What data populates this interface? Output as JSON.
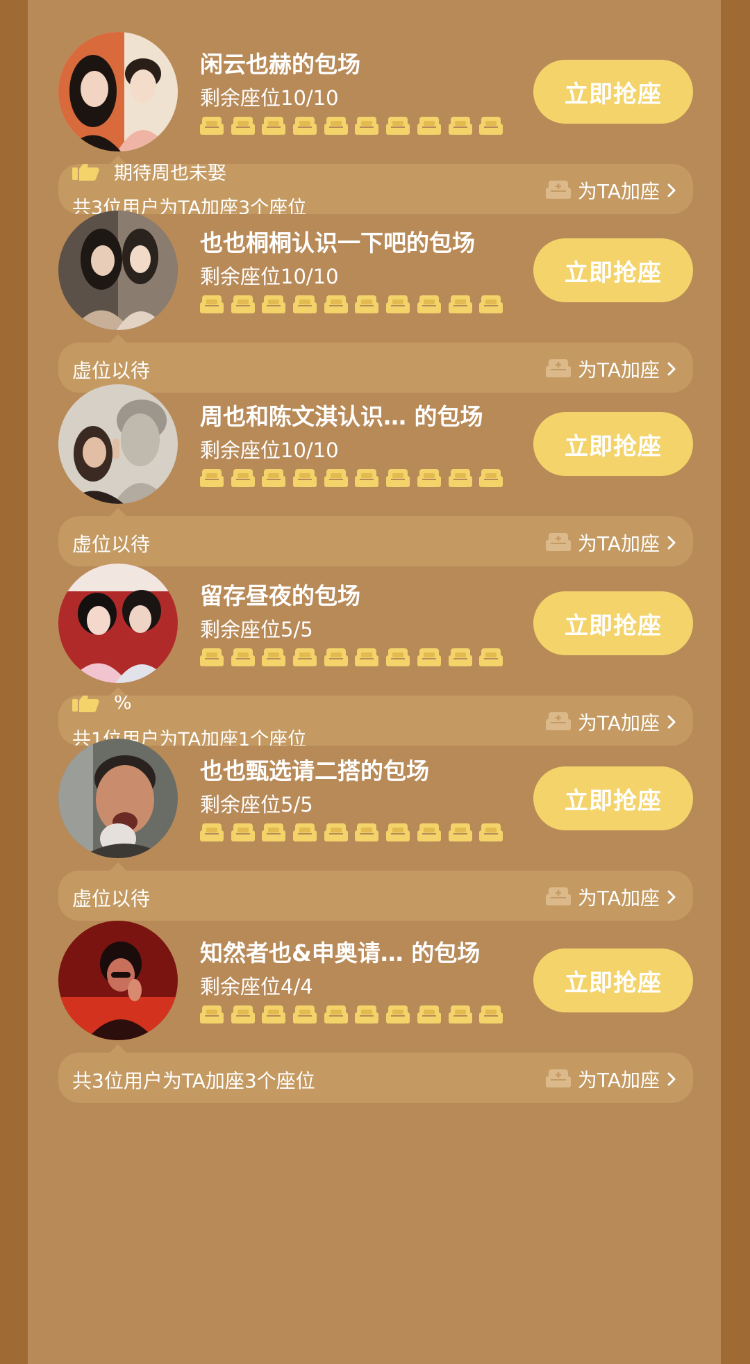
{
  "colors": {
    "page_background": "#a06a35",
    "panel": "#b88a58",
    "button": "#f3d36a",
    "seat": "#f3d36a",
    "bubble": "#c49a62"
  },
  "cards": [
    {
      "title": "闲云也赫的包场",
      "remaining": "剩余座位10/10",
      "seat_count": 10,
      "button_label": "立即抢座",
      "bubble_type": "scroll",
      "bubble_line1": "期待周也未娶",
      "bubble_line2": "共3位用户为TA加座3个座位",
      "add_label": "为TA加座",
      "avatar_icon": "couple-photo"
    },
    {
      "title": "也也桐桐认识一下吧的包场",
      "remaining": "剩余座位10/10",
      "seat_count": 10,
      "button_label": "立即抢座",
      "bubble_type": "text",
      "bubble_text": "虚位以待",
      "add_label": "为TA加座",
      "avatar_icon": "two-women-photo"
    },
    {
      "title": "周也和陈文淇认识… 的包场",
      "remaining": "剩余座位10/10",
      "seat_count": 10,
      "button_label": "立即抢座",
      "bubble_type": "text",
      "bubble_text": "虚位以待",
      "add_label": "为TA加座",
      "avatar_icon": "statue-photo"
    },
    {
      "title": "留存昼夜的包场",
      "remaining": "剩余座位5/5",
      "seat_count": 10,
      "button_label": "立即抢座",
      "bubble_type": "scroll",
      "bubble_line1": "%",
      "bubble_line2": "共1位用户为TA加座1个座位",
      "add_label": "为TA加座",
      "avatar_icon": "two-women-red-photo"
    },
    {
      "title": "也也甄选请二搭的包场",
      "remaining": "剩余座位5/5",
      "seat_count": 10,
      "button_label": "立即抢座",
      "bubble_type": "text",
      "bubble_text": "虚位以待",
      "add_label": "为TA加座",
      "avatar_icon": "crying-man-photo"
    },
    {
      "title": "知然者也&申奥请… 的包场",
      "remaining": "剩余座位4/4",
      "seat_count": 10,
      "button_label": "立即抢座",
      "bubble_type": "text",
      "bubble_text": "共3位用户为TA加座3个座位",
      "add_label": "为TA加座",
      "avatar_icon": "red-stage-photo"
    }
  ]
}
